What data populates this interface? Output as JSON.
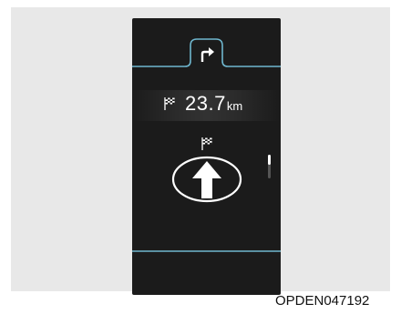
{
  "nav": {
    "tab_icon": "turn-right-arrow-icon",
    "distance_flag_icon": "checkered-flag-icon",
    "distance_value": "23.7",
    "distance_unit": "km",
    "destination_flag_icon": "checkered-flag-icon",
    "direction_icon": "straight-ahead-arrow-icon"
  },
  "figure_code": "OPDEN047192",
  "colors": {
    "accent_line": "#6fb7cf",
    "screen_bg": "#1b1b1b",
    "panel_bg": "#e8e8e8",
    "text": "#ffffff"
  }
}
